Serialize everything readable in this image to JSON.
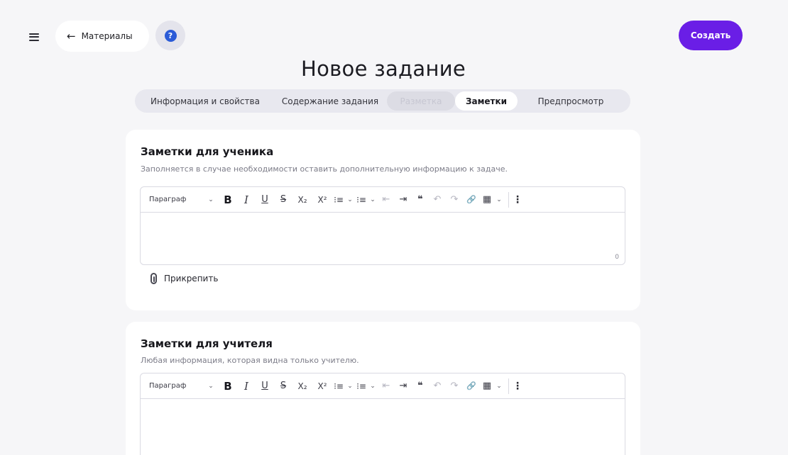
{
  "header": {
    "back_label": "Материалы",
    "back_arrow": "←",
    "help_glyph": "?",
    "create_label": "Создать",
    "title": "Новое задание"
  },
  "tabs": [
    {
      "label": "Информация и свойства",
      "state": "normal"
    },
    {
      "label": "Содержание задания",
      "state": "normal"
    },
    {
      "label": "Разметка",
      "state": "disabled"
    },
    {
      "label": "Заметки",
      "state": "active"
    },
    {
      "label": "Предпросмотр",
      "state": "normal"
    }
  ],
  "toolbar": {
    "paragraph": "Параграф",
    "bold": "B",
    "italic": "I",
    "underline": "U",
    "strike": "S",
    "subscript": "X₂",
    "superscript": "X²",
    "ordered_list": "⁝≡",
    "bullet_list": "⁝≡",
    "outdent": "⇤",
    "indent": "⇥",
    "quote": "❝",
    "undo": "↶",
    "redo": "↷",
    "link": "🔗",
    "table": "▦",
    "chevron": "⌄",
    "more": "⋮"
  },
  "student_notes": {
    "title": "Заметки для ученика",
    "description": "Заполняется в случае необходимости оставить дополнительную информацию к задаче.",
    "char_count": "0",
    "attach_label": "Прикрепить"
  },
  "teacher_notes": {
    "title": "Заметки для учителя",
    "description": "Любая информация, которая видна только учителю."
  },
  "colors": {
    "accent": "#6a1ee6",
    "help": "#2b5bd7",
    "background": "#f6f6f8"
  }
}
